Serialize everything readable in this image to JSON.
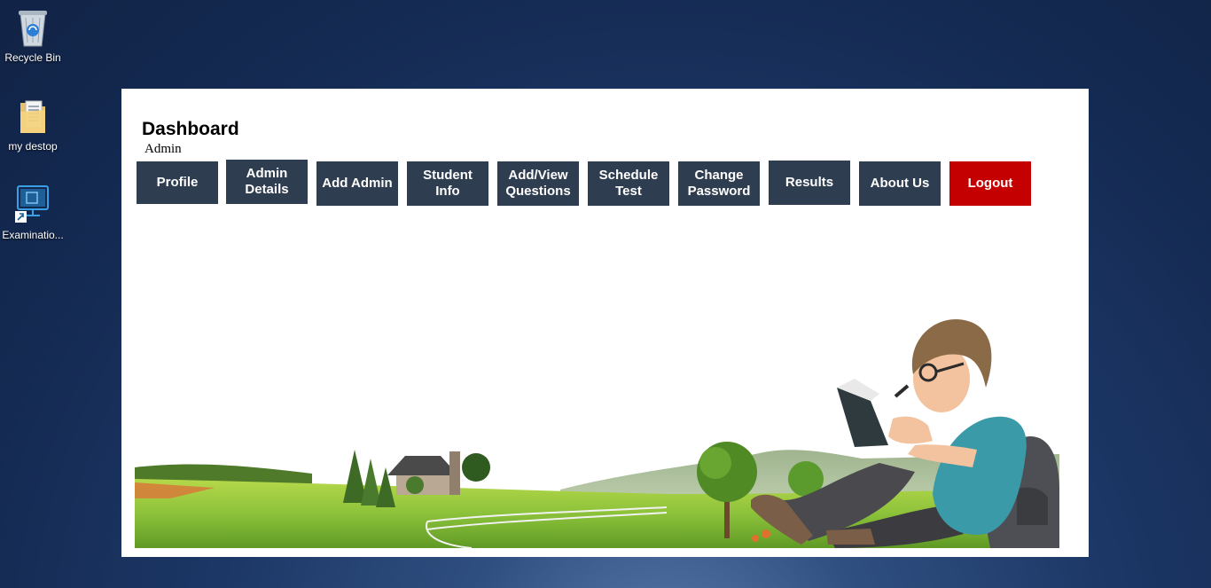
{
  "desktop": {
    "icons": [
      {
        "label": "Recycle Bin",
        "icon": "recycle-bin-icon"
      },
      {
        "label": "my destop",
        "icon": "folder-icon"
      },
      {
        "label": "Examinatio...",
        "icon": "application-shortcut-icon"
      }
    ]
  },
  "dashboard": {
    "title": "Dashboard",
    "role": "Admin",
    "nav": [
      {
        "label": "Profile"
      },
      {
        "label": "Admin\nDetails"
      },
      {
        "label": "Add Admin"
      },
      {
        "label": "Student\nInfo"
      },
      {
        "label": "Add/View\nQuestions"
      },
      {
        "label": "Schedule\nTest"
      },
      {
        "label": "Change\nPassword"
      },
      {
        "label": "Results"
      },
      {
        "label": "About Us"
      },
      {
        "label": "Logout"
      }
    ]
  },
  "colors": {
    "nav_button": "#2f3d50",
    "logout_button": "#c40000",
    "desktop_background": "#1c3766"
  }
}
